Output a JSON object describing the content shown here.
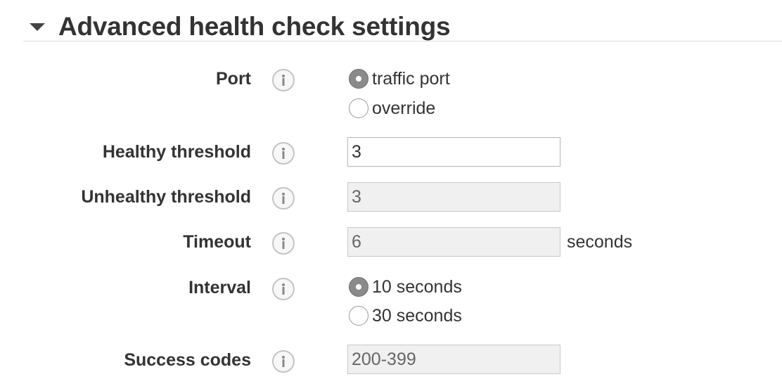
{
  "section": {
    "title": "Advanced health check settings"
  },
  "port": {
    "label": "Port",
    "options": [
      {
        "label": "traffic port",
        "selected": true
      },
      {
        "label": "override",
        "selected": false
      }
    ]
  },
  "healthy_threshold": {
    "label": "Healthy threshold",
    "value": "3"
  },
  "unhealthy_threshold": {
    "label": "Unhealthy threshold",
    "value": "3"
  },
  "timeout": {
    "label": "Timeout",
    "value": "6",
    "unit": "seconds"
  },
  "interval": {
    "label": "Interval",
    "options": [
      {
        "label": "10 seconds",
        "selected": true
      },
      {
        "label": "30 seconds",
        "selected": false
      }
    ]
  },
  "success_codes": {
    "label": "Success codes",
    "value": "200-399"
  },
  "icons": {
    "info": "info-icon",
    "collapse": "caret-down-icon"
  },
  "colors": {
    "disabled_bg": "#f0f0f0",
    "radio_checked": "#8a8a8a"
  }
}
